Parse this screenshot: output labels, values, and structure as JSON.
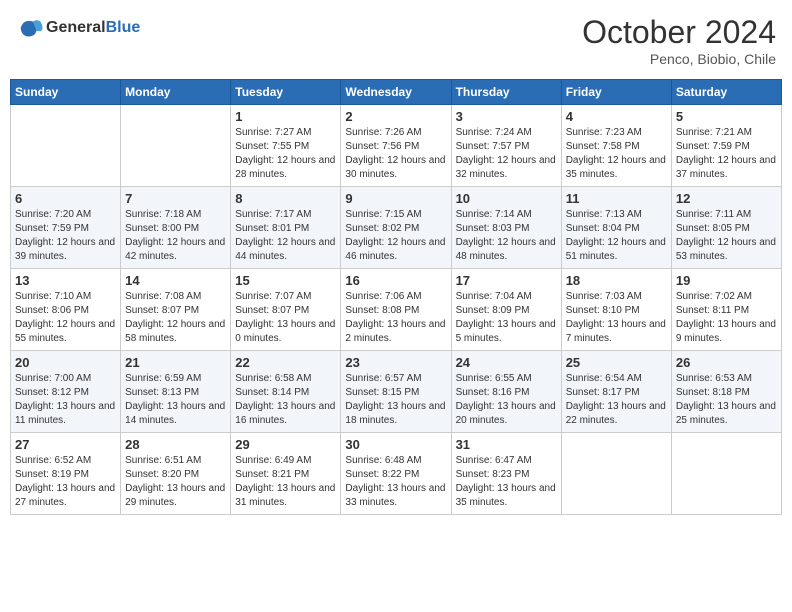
{
  "header": {
    "logo_line1": "General",
    "logo_line2": "Blue",
    "month": "October 2024",
    "location": "Penco, Biobio, Chile"
  },
  "weekdays": [
    "Sunday",
    "Monday",
    "Tuesday",
    "Wednesday",
    "Thursday",
    "Friday",
    "Saturday"
  ],
  "weeks": [
    [
      {
        "day": "",
        "sunrise": "",
        "sunset": "",
        "daylight": ""
      },
      {
        "day": "",
        "sunrise": "",
        "sunset": "",
        "daylight": ""
      },
      {
        "day": "1",
        "sunrise": "Sunrise: 7:27 AM",
        "sunset": "Sunset: 7:55 PM",
        "daylight": "Daylight: 12 hours and 28 minutes."
      },
      {
        "day": "2",
        "sunrise": "Sunrise: 7:26 AM",
        "sunset": "Sunset: 7:56 PM",
        "daylight": "Daylight: 12 hours and 30 minutes."
      },
      {
        "day": "3",
        "sunrise": "Sunrise: 7:24 AM",
        "sunset": "Sunset: 7:57 PM",
        "daylight": "Daylight: 12 hours and 32 minutes."
      },
      {
        "day": "4",
        "sunrise": "Sunrise: 7:23 AM",
        "sunset": "Sunset: 7:58 PM",
        "daylight": "Daylight: 12 hours and 35 minutes."
      },
      {
        "day": "5",
        "sunrise": "Sunrise: 7:21 AM",
        "sunset": "Sunset: 7:59 PM",
        "daylight": "Daylight: 12 hours and 37 minutes."
      }
    ],
    [
      {
        "day": "6",
        "sunrise": "Sunrise: 7:20 AM",
        "sunset": "Sunset: 7:59 PM",
        "daylight": "Daylight: 12 hours and 39 minutes."
      },
      {
        "day": "7",
        "sunrise": "Sunrise: 7:18 AM",
        "sunset": "Sunset: 8:00 PM",
        "daylight": "Daylight: 12 hours and 42 minutes."
      },
      {
        "day": "8",
        "sunrise": "Sunrise: 7:17 AM",
        "sunset": "Sunset: 8:01 PM",
        "daylight": "Daylight: 12 hours and 44 minutes."
      },
      {
        "day": "9",
        "sunrise": "Sunrise: 7:15 AM",
        "sunset": "Sunset: 8:02 PM",
        "daylight": "Daylight: 12 hours and 46 minutes."
      },
      {
        "day": "10",
        "sunrise": "Sunrise: 7:14 AM",
        "sunset": "Sunset: 8:03 PM",
        "daylight": "Daylight: 12 hours and 48 minutes."
      },
      {
        "day": "11",
        "sunrise": "Sunrise: 7:13 AM",
        "sunset": "Sunset: 8:04 PM",
        "daylight": "Daylight: 12 hours and 51 minutes."
      },
      {
        "day": "12",
        "sunrise": "Sunrise: 7:11 AM",
        "sunset": "Sunset: 8:05 PM",
        "daylight": "Daylight: 12 hours and 53 minutes."
      }
    ],
    [
      {
        "day": "13",
        "sunrise": "Sunrise: 7:10 AM",
        "sunset": "Sunset: 8:06 PM",
        "daylight": "Daylight: 12 hours and 55 minutes."
      },
      {
        "day": "14",
        "sunrise": "Sunrise: 7:08 AM",
        "sunset": "Sunset: 8:07 PM",
        "daylight": "Daylight: 12 hours and 58 minutes."
      },
      {
        "day": "15",
        "sunrise": "Sunrise: 7:07 AM",
        "sunset": "Sunset: 8:07 PM",
        "daylight": "Daylight: 13 hours and 0 minutes."
      },
      {
        "day": "16",
        "sunrise": "Sunrise: 7:06 AM",
        "sunset": "Sunset: 8:08 PM",
        "daylight": "Daylight: 13 hours and 2 minutes."
      },
      {
        "day": "17",
        "sunrise": "Sunrise: 7:04 AM",
        "sunset": "Sunset: 8:09 PM",
        "daylight": "Daylight: 13 hours and 5 minutes."
      },
      {
        "day": "18",
        "sunrise": "Sunrise: 7:03 AM",
        "sunset": "Sunset: 8:10 PM",
        "daylight": "Daylight: 13 hours and 7 minutes."
      },
      {
        "day": "19",
        "sunrise": "Sunrise: 7:02 AM",
        "sunset": "Sunset: 8:11 PM",
        "daylight": "Daylight: 13 hours and 9 minutes."
      }
    ],
    [
      {
        "day": "20",
        "sunrise": "Sunrise: 7:00 AM",
        "sunset": "Sunset: 8:12 PM",
        "daylight": "Daylight: 13 hours and 11 minutes."
      },
      {
        "day": "21",
        "sunrise": "Sunrise: 6:59 AM",
        "sunset": "Sunset: 8:13 PM",
        "daylight": "Daylight: 13 hours and 14 minutes."
      },
      {
        "day": "22",
        "sunrise": "Sunrise: 6:58 AM",
        "sunset": "Sunset: 8:14 PM",
        "daylight": "Daylight: 13 hours and 16 minutes."
      },
      {
        "day": "23",
        "sunrise": "Sunrise: 6:57 AM",
        "sunset": "Sunset: 8:15 PM",
        "daylight": "Daylight: 13 hours and 18 minutes."
      },
      {
        "day": "24",
        "sunrise": "Sunrise: 6:55 AM",
        "sunset": "Sunset: 8:16 PM",
        "daylight": "Daylight: 13 hours and 20 minutes."
      },
      {
        "day": "25",
        "sunrise": "Sunrise: 6:54 AM",
        "sunset": "Sunset: 8:17 PM",
        "daylight": "Daylight: 13 hours and 22 minutes."
      },
      {
        "day": "26",
        "sunrise": "Sunrise: 6:53 AM",
        "sunset": "Sunset: 8:18 PM",
        "daylight": "Daylight: 13 hours and 25 minutes."
      }
    ],
    [
      {
        "day": "27",
        "sunrise": "Sunrise: 6:52 AM",
        "sunset": "Sunset: 8:19 PM",
        "daylight": "Daylight: 13 hours and 27 minutes."
      },
      {
        "day": "28",
        "sunrise": "Sunrise: 6:51 AM",
        "sunset": "Sunset: 8:20 PM",
        "daylight": "Daylight: 13 hours and 29 minutes."
      },
      {
        "day": "29",
        "sunrise": "Sunrise: 6:49 AM",
        "sunset": "Sunset: 8:21 PM",
        "daylight": "Daylight: 13 hours and 31 minutes."
      },
      {
        "day": "30",
        "sunrise": "Sunrise: 6:48 AM",
        "sunset": "Sunset: 8:22 PM",
        "daylight": "Daylight: 13 hours and 33 minutes."
      },
      {
        "day": "31",
        "sunrise": "Sunrise: 6:47 AM",
        "sunset": "Sunset: 8:23 PM",
        "daylight": "Daylight: 13 hours and 35 minutes."
      },
      {
        "day": "",
        "sunrise": "",
        "sunset": "",
        "daylight": ""
      },
      {
        "day": "",
        "sunrise": "",
        "sunset": "",
        "daylight": ""
      }
    ]
  ]
}
